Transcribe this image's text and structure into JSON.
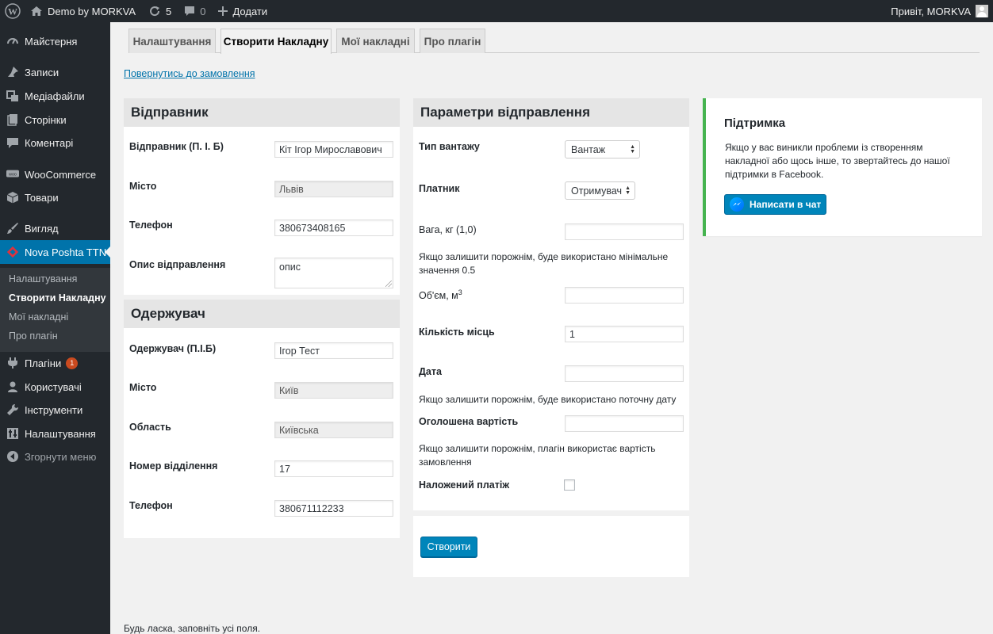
{
  "adminbar": {
    "site_name": "Demo by MORKVA",
    "updates_count": "5",
    "comments_count": "0",
    "add_label": "Додати",
    "greeting": "Привіт, MORKVA"
  },
  "sidebar": {
    "items": [
      {
        "label": "Майстерня",
        "icon": "dashboard-icon"
      },
      {
        "label": "Записи",
        "icon": "pin-icon"
      },
      {
        "label": "Медіафайли",
        "icon": "media-icon"
      },
      {
        "label": "Сторінки",
        "icon": "page-icon"
      },
      {
        "label": "Коментарі",
        "icon": "comment-icon"
      },
      {
        "label": "WooCommerce",
        "icon": "woocommerce-icon"
      },
      {
        "label": "Товари",
        "icon": "box-icon"
      },
      {
        "label": "Вигляд",
        "icon": "brush-icon"
      },
      {
        "label": "Nova Poshta TTN",
        "icon": "nova-poshta-icon"
      },
      {
        "label": "Плагіни",
        "icon": "plugin-icon",
        "badge": "1"
      },
      {
        "label": "Користувачі",
        "icon": "user-icon"
      },
      {
        "label": "Інструменти",
        "icon": "wrench-icon"
      },
      {
        "label": "Налаштування",
        "icon": "settings-icon"
      },
      {
        "label": "Згорнути меню",
        "icon": "collapse-icon"
      }
    ],
    "submenu": [
      "Налаштування",
      "Створити Накладну",
      "Мої накладні",
      "Про плагін"
    ]
  },
  "tabs": [
    "Налаштування",
    "Створити Накладну",
    "Мої накладні",
    "Про плагін"
  ],
  "back_link": "Повернутись до замовлення",
  "sender": {
    "title": "Відправник",
    "fields": [
      {
        "label": "Відправник (П. І. Б)",
        "value": "Кіт Ігор Мирославович"
      },
      {
        "label": "Місто",
        "value": "Львів"
      },
      {
        "label": "Телефон",
        "value": "380673408165"
      },
      {
        "label": "Опис відправлення",
        "value": "опис"
      }
    ]
  },
  "recipient": {
    "title": "Одержувач",
    "fields": [
      {
        "label": "Одержувач (П.І.Б)",
        "value": "Ігор Тест"
      },
      {
        "label": "Місто",
        "value": "Київ"
      },
      {
        "label": "Область",
        "value": "Київська"
      },
      {
        "label": "Номер відділення",
        "value": "17"
      },
      {
        "label": "Телефон",
        "value": "380671112233"
      }
    ]
  },
  "shipment": {
    "title": "Параметри відправлення",
    "cargo_type_label": "Тип вантажу",
    "cargo_type_value": "Вантаж",
    "payer_label": "Платник",
    "payer_value": "Отримувач",
    "weight_label": "Вага, кг (1,0)",
    "weight_value": "",
    "weight_hint": "Якщо залишити порожнім, буде використано мінімальне значення 0.5",
    "volume_label": "Об'єм, м",
    "volume_sup": "3",
    "volume_value": "",
    "places_label": "Кількість місць",
    "places_value": "1",
    "date_label": "Дата",
    "date_value": "",
    "date_hint": "Якщо залишити порожнім, буде використано поточну дату",
    "declared_label": "Оголошена вартість",
    "declared_value": "",
    "declared_hint": "Якщо залишити порожнім, плагін використає вартість замовлення",
    "cod_label": "Наложений платіж",
    "create_button": "Створити"
  },
  "support": {
    "title": "Підтримка",
    "text": "Якщо у вас виникли проблеми із створенням накладної або щось інше, то звертайтесь до нашої підтримки в Facebook.",
    "button": "Написати в чат"
  },
  "footer_note": "Будь ласка, заповніть усі поля."
}
